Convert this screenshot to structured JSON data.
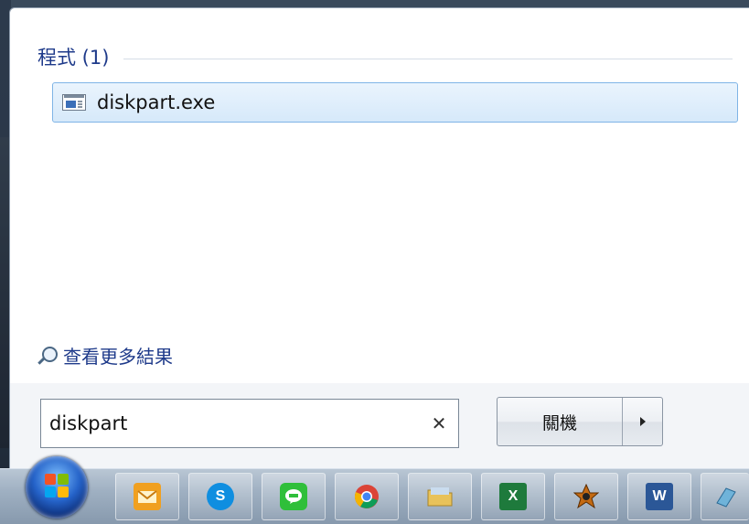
{
  "results": {
    "section_title": "程式 (1)",
    "items": [
      {
        "label": "diskpart.exe",
        "icon": "console-app-icon"
      }
    ],
    "see_more_label": "查看更多結果"
  },
  "search": {
    "value": "diskpart",
    "clear_glyph": "✕"
  },
  "shutdown": {
    "label": "關機"
  },
  "taskbar": {
    "items": [
      {
        "name": "outlook",
        "icon": "outlook-icon",
        "color": "#f0a020"
      },
      {
        "name": "skype",
        "icon": "skype-icon",
        "glyph": "S",
        "color": "#0f8ee0"
      },
      {
        "name": "line",
        "icon": "line-icon",
        "glyph": "LINE",
        "color": "#2fbf3a"
      },
      {
        "name": "chrome",
        "icon": "chrome-icon",
        "color": "#e33b2e"
      },
      {
        "name": "file-explorer",
        "icon": "folder-icon",
        "color": "#e8c25a"
      },
      {
        "name": "excel",
        "icon": "excel-icon",
        "glyph": "X",
        "color": "#1e7a3c"
      },
      {
        "name": "app-7",
        "icon": "app-icon",
        "color": "#c46a12"
      },
      {
        "name": "word",
        "icon": "word-icon",
        "glyph": "W",
        "color": "#2b5797"
      },
      {
        "name": "app-9",
        "icon": "app-icon",
        "color": "#6fb3d9"
      }
    ]
  }
}
